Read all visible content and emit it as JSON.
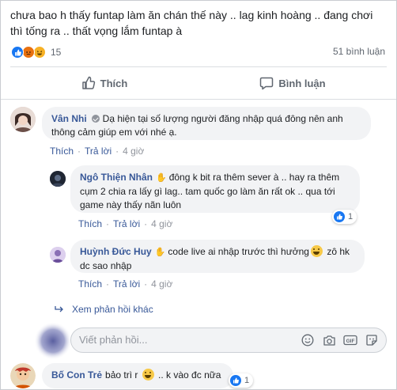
{
  "post": {
    "text": "chưa bao h thấy funtap làm ăn chán thế này .. lag kinh hoàng .. đang chơi thì tống ra .. thất vọng lắm funtap à",
    "reaction_icons": [
      "like-icon",
      "angry-icon",
      "haha-icon"
    ],
    "reaction_count": "15",
    "comment_count": "51 bình luận"
  },
  "actions": {
    "like": "Thích",
    "comment": "Bình luận"
  },
  "comments": [
    {
      "author": "Vân Nhi",
      "text": "Dạ hiện tại số lượng người đăng nhập quá đông nên anh thông cảm giúp em với nhé ạ.",
      "like": "Thích",
      "reply": "Trả lời",
      "time": "4 giờ"
    }
  ],
  "replies": [
    {
      "author": "Ngô Thiện Nhân",
      "text": "đông k bit ra thêm sever à .. hay ra thêm cụm 2 chia ra lấy gì lag.. tam quốc go làm ăn rất ok .. qua tới game này thấy nãn luôn",
      "like": "Thích",
      "reply": "Trả lời",
      "time": "4 giờ",
      "likes": "1"
    },
    {
      "author": "Huỳnh Đức Huy",
      "text_before": "code live ai nhập trước thì hưởng",
      "text_after": " zô hk dc sao nhập",
      "like": "Thích",
      "reply": "Trả lời",
      "time": "4 giờ"
    }
  ],
  "more_replies": "Xem phản hồi khác",
  "reply_box": {
    "placeholder": "Viết phản hồi...",
    "icons": [
      "smiley-icon",
      "camera-icon",
      "gif-icon",
      "sticker-icon"
    ]
  },
  "bottom_comment": {
    "author": "Bố Con Trẻ",
    "text_before": "bảo trì r ",
    "text_after": " .. k vào đc nữa",
    "likes": "1"
  },
  "colors": {
    "link": "#385898",
    "like_blue": "#1877f2",
    "bubble": "#f2f3f5",
    "meta_gray": "#606770"
  }
}
